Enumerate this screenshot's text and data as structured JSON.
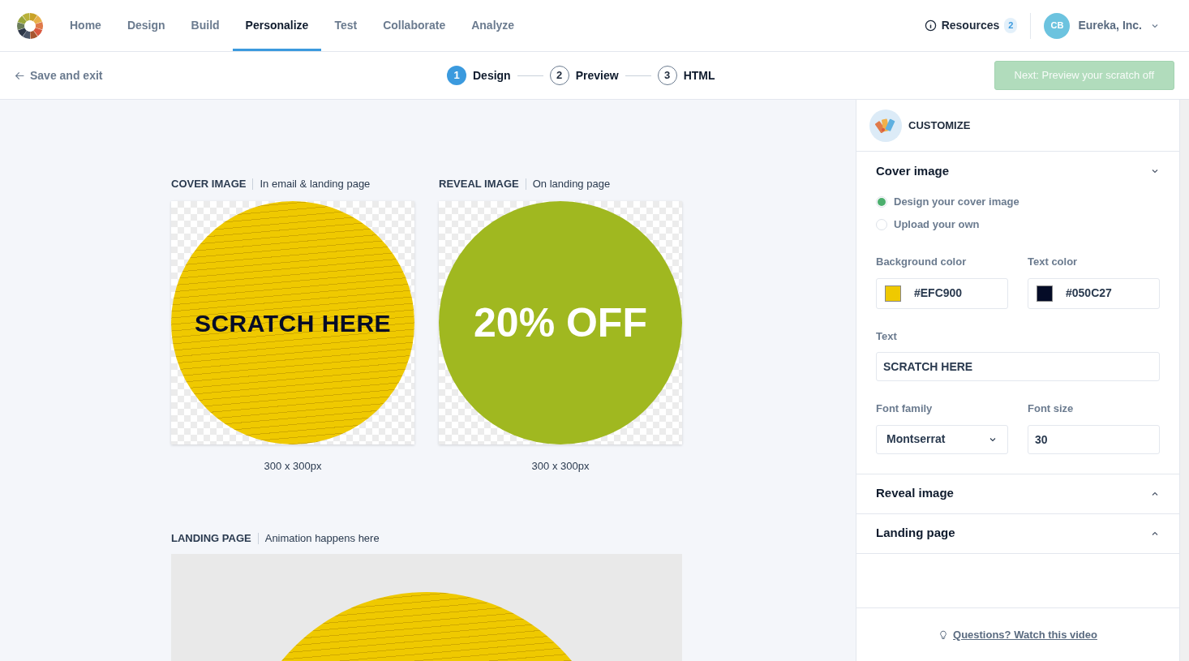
{
  "nav": {
    "items": [
      {
        "label": "Home",
        "selected": false
      },
      {
        "label": "Design",
        "selected": false
      },
      {
        "label": "Build",
        "selected": false
      },
      {
        "label": "Personalize",
        "selected": true
      },
      {
        "label": "Test",
        "selected": false
      },
      {
        "label": "Collaborate",
        "selected": false
      },
      {
        "label": "Analyze",
        "selected": false
      }
    ],
    "resources": {
      "label": "Resources",
      "count": "2"
    },
    "account": {
      "initials": "CB",
      "name": "Eureka, Inc."
    }
  },
  "toolbar": {
    "save_exit": "Save and exit",
    "steps": [
      {
        "number": "1",
        "label": "Design",
        "selected": true
      },
      {
        "number": "2",
        "label": "Preview",
        "selected": false
      },
      {
        "number": "3",
        "label": "HTML",
        "selected": false
      }
    ],
    "next_button": {
      "label": "Next: Preview your scratch off",
      "disabled": true
    }
  },
  "canvas": {
    "previews": [
      {
        "kind": "cover",
        "title": "COVER IMAGE",
        "subtitle": "In email & landing page",
        "text": "SCRATCH HERE",
        "size": "300 x 300px"
      },
      {
        "kind": "reveal",
        "title": "REVEAL IMAGE",
        "subtitle": "On landing page",
        "text": "20% OFF",
        "size": "300 x 300px"
      }
    ],
    "landing": {
      "title": "LANDING PAGE",
      "subtitle": "Animation happens here"
    }
  },
  "panel": {
    "title": "CUSTOMIZE",
    "sections": [
      {
        "title": "Cover image",
        "expanded": true
      },
      {
        "title": "Reveal image",
        "expanded": false
      },
      {
        "title": "Landing page",
        "expanded": false
      }
    ],
    "options": [
      {
        "label": "Design your cover image",
        "selected": true
      },
      {
        "label": "Upload your own",
        "selected": false
      }
    ],
    "background_color": {
      "label": "Background color",
      "value": "#EFC900"
    },
    "text_color": {
      "label": "Text color",
      "value": "#050C27"
    },
    "text": {
      "label": "Text",
      "value": "SCRATCH HERE"
    },
    "font_family": {
      "label": "Font family",
      "value": "Montserrat"
    },
    "font_size": {
      "label": "Font size",
      "value": "30"
    },
    "help_link": "Questions? Watch this video"
  }
}
